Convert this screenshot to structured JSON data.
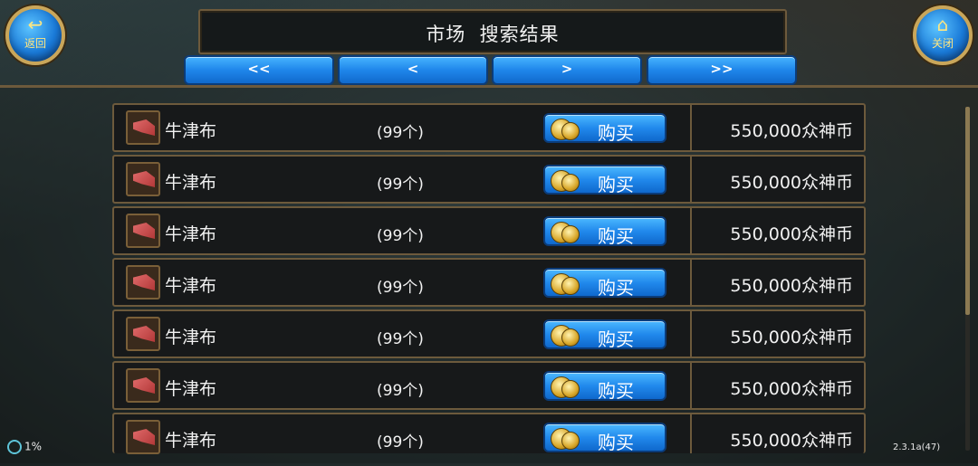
{
  "header": {
    "title": "市场  搜索结果",
    "back": {
      "icon": "back-arrow-icon",
      "label": "返回"
    },
    "close": {
      "icon": "home-icon",
      "label": "关闭"
    }
  },
  "pagination": {
    "first": "<<",
    "prev": "<",
    "next": ">",
    "last": ">>"
  },
  "listings": [
    {
      "name": "牛津布",
      "qty": "(99个)",
      "buy_label": "购买",
      "price": "550,000众神币"
    },
    {
      "name": "牛津布",
      "qty": "(99个)",
      "buy_label": "购买",
      "price": "550,000众神币"
    },
    {
      "name": "牛津布",
      "qty": "(99个)",
      "buy_label": "购买",
      "price": "550,000众神币"
    },
    {
      "name": "牛津布",
      "qty": "(99个)",
      "buy_label": "购买",
      "price": "550,000众神币"
    },
    {
      "name": "牛津布",
      "qty": "(99个)",
      "buy_label": "购买",
      "price": "550,000众神币"
    },
    {
      "name": "牛津布",
      "qty": "(99个)",
      "buy_label": "购买",
      "price": "550,000众神币"
    },
    {
      "name": "牛津布",
      "qty": "(99个)",
      "buy_label": "购买",
      "price": "550,000众神币"
    }
  ],
  "status": {
    "percent": "1%",
    "version": "2.3.1a(47)"
  },
  "colors": {
    "button_blue": "#2189ec",
    "frame_gold": "#6d5a3c",
    "row_bg": "#17191a"
  }
}
